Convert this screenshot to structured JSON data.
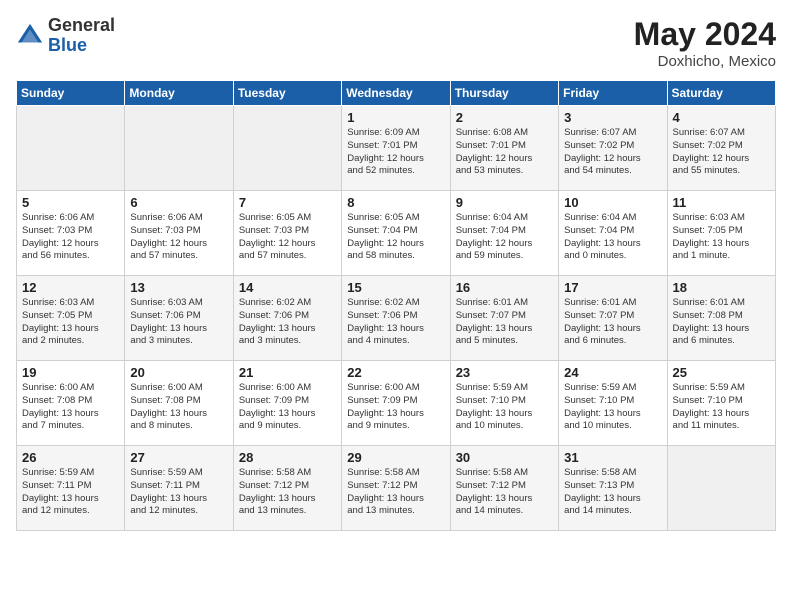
{
  "header": {
    "logo_general": "General",
    "logo_blue": "Blue",
    "month_year": "May 2024",
    "location": "Doxhicho, Mexico"
  },
  "days_of_week": [
    "Sunday",
    "Monday",
    "Tuesday",
    "Wednesday",
    "Thursday",
    "Friday",
    "Saturday"
  ],
  "weeks": [
    [
      {
        "day": "",
        "info": ""
      },
      {
        "day": "",
        "info": ""
      },
      {
        "day": "",
        "info": ""
      },
      {
        "day": "1",
        "info": "Sunrise: 6:09 AM\nSunset: 7:01 PM\nDaylight: 12 hours\nand 52 minutes."
      },
      {
        "day": "2",
        "info": "Sunrise: 6:08 AM\nSunset: 7:01 PM\nDaylight: 12 hours\nand 53 minutes."
      },
      {
        "day": "3",
        "info": "Sunrise: 6:07 AM\nSunset: 7:02 PM\nDaylight: 12 hours\nand 54 minutes."
      },
      {
        "day": "4",
        "info": "Sunrise: 6:07 AM\nSunset: 7:02 PM\nDaylight: 12 hours\nand 55 minutes."
      }
    ],
    [
      {
        "day": "5",
        "info": "Sunrise: 6:06 AM\nSunset: 7:03 PM\nDaylight: 12 hours\nand 56 minutes."
      },
      {
        "day": "6",
        "info": "Sunrise: 6:06 AM\nSunset: 7:03 PM\nDaylight: 12 hours\nand 57 minutes."
      },
      {
        "day": "7",
        "info": "Sunrise: 6:05 AM\nSunset: 7:03 PM\nDaylight: 12 hours\nand 57 minutes."
      },
      {
        "day": "8",
        "info": "Sunrise: 6:05 AM\nSunset: 7:04 PM\nDaylight: 12 hours\nand 58 minutes."
      },
      {
        "day": "9",
        "info": "Sunrise: 6:04 AM\nSunset: 7:04 PM\nDaylight: 12 hours\nand 59 minutes."
      },
      {
        "day": "10",
        "info": "Sunrise: 6:04 AM\nSunset: 7:04 PM\nDaylight: 13 hours\nand 0 minutes."
      },
      {
        "day": "11",
        "info": "Sunrise: 6:03 AM\nSunset: 7:05 PM\nDaylight: 13 hours\nand 1 minute."
      }
    ],
    [
      {
        "day": "12",
        "info": "Sunrise: 6:03 AM\nSunset: 7:05 PM\nDaylight: 13 hours\nand 2 minutes."
      },
      {
        "day": "13",
        "info": "Sunrise: 6:03 AM\nSunset: 7:06 PM\nDaylight: 13 hours\nand 3 minutes."
      },
      {
        "day": "14",
        "info": "Sunrise: 6:02 AM\nSunset: 7:06 PM\nDaylight: 13 hours\nand 3 minutes."
      },
      {
        "day": "15",
        "info": "Sunrise: 6:02 AM\nSunset: 7:06 PM\nDaylight: 13 hours\nand 4 minutes."
      },
      {
        "day": "16",
        "info": "Sunrise: 6:01 AM\nSunset: 7:07 PM\nDaylight: 13 hours\nand 5 minutes."
      },
      {
        "day": "17",
        "info": "Sunrise: 6:01 AM\nSunset: 7:07 PM\nDaylight: 13 hours\nand 6 minutes."
      },
      {
        "day": "18",
        "info": "Sunrise: 6:01 AM\nSunset: 7:08 PM\nDaylight: 13 hours\nand 6 minutes."
      }
    ],
    [
      {
        "day": "19",
        "info": "Sunrise: 6:00 AM\nSunset: 7:08 PM\nDaylight: 13 hours\nand 7 minutes."
      },
      {
        "day": "20",
        "info": "Sunrise: 6:00 AM\nSunset: 7:08 PM\nDaylight: 13 hours\nand 8 minutes."
      },
      {
        "day": "21",
        "info": "Sunrise: 6:00 AM\nSunset: 7:09 PM\nDaylight: 13 hours\nand 9 minutes."
      },
      {
        "day": "22",
        "info": "Sunrise: 6:00 AM\nSunset: 7:09 PM\nDaylight: 13 hours\nand 9 minutes."
      },
      {
        "day": "23",
        "info": "Sunrise: 5:59 AM\nSunset: 7:10 PM\nDaylight: 13 hours\nand 10 minutes."
      },
      {
        "day": "24",
        "info": "Sunrise: 5:59 AM\nSunset: 7:10 PM\nDaylight: 13 hours\nand 10 minutes."
      },
      {
        "day": "25",
        "info": "Sunrise: 5:59 AM\nSunset: 7:10 PM\nDaylight: 13 hours\nand 11 minutes."
      }
    ],
    [
      {
        "day": "26",
        "info": "Sunrise: 5:59 AM\nSunset: 7:11 PM\nDaylight: 13 hours\nand 12 minutes."
      },
      {
        "day": "27",
        "info": "Sunrise: 5:59 AM\nSunset: 7:11 PM\nDaylight: 13 hours\nand 12 minutes."
      },
      {
        "day": "28",
        "info": "Sunrise: 5:58 AM\nSunset: 7:12 PM\nDaylight: 13 hours\nand 13 minutes."
      },
      {
        "day": "29",
        "info": "Sunrise: 5:58 AM\nSunset: 7:12 PM\nDaylight: 13 hours\nand 13 minutes."
      },
      {
        "day": "30",
        "info": "Sunrise: 5:58 AM\nSunset: 7:12 PM\nDaylight: 13 hours\nand 14 minutes."
      },
      {
        "day": "31",
        "info": "Sunrise: 5:58 AM\nSunset: 7:13 PM\nDaylight: 13 hours\nand 14 minutes."
      },
      {
        "day": "",
        "info": ""
      }
    ]
  ]
}
